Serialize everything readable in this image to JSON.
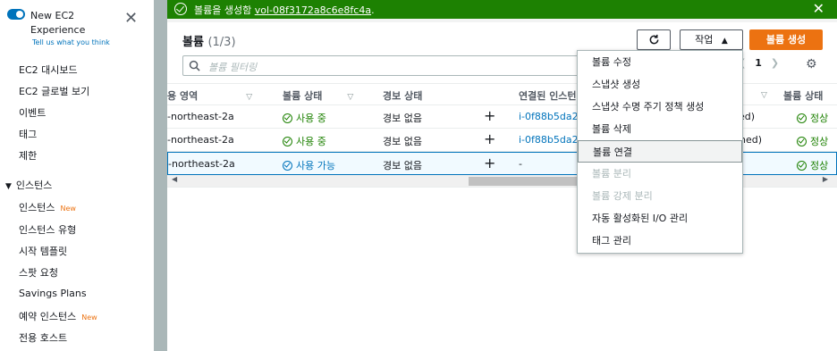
{
  "sidebar": {
    "title": "New EC2 Experience",
    "subtitle": "Tell us what you think",
    "items": [
      {
        "label": "EC2 대시보드"
      },
      {
        "label": "EC2 글로벌 보기"
      },
      {
        "label": "이벤트"
      },
      {
        "label": "태그"
      },
      {
        "label": "제한"
      }
    ],
    "section": "인스턴스",
    "section_items": [
      {
        "label": "인스턴스",
        "badge": "New"
      },
      {
        "label": "인스턴스 유형"
      },
      {
        "label": "시작 템플릿"
      },
      {
        "label": "스팟 요청"
      },
      {
        "label": "Savings Plans"
      },
      {
        "label": "예약 인스턴스",
        "badge": "New"
      },
      {
        "label": "전용 호스트"
      }
    ]
  },
  "flash": {
    "text": "볼륨을 생성함",
    "volume_id": "vol-08f3172a8c6e8fc4a",
    "period": "."
  },
  "panel": {
    "title": "볼륨",
    "count": "(1/3)",
    "action_label": "작업",
    "create_label": "볼륨 생성",
    "search_placeholder": "볼륨 필터링",
    "page": "1"
  },
  "table": {
    "headers": [
      "용 영역",
      "볼륨 상태",
      "경보 상태",
      "연결된 인스턴",
      "볼륨 상태"
    ],
    "rows": [
      {
        "az": "-northeast-2a",
        "state": "사용 중",
        "alarm": "경보 없음",
        "instance": "i-0f88b5da2",
        "attach": "hed)",
        "status": "정상"
      },
      {
        "az": "-northeast-2a",
        "state": "사용 중",
        "alarm": "경보 없음",
        "instance": "i-0f88b5da2",
        "attach": "hed)",
        "status": "정상"
      },
      {
        "az": "-northeast-2a",
        "state": "사용 가능",
        "alarm": "경보 없음",
        "instance": "-",
        "attach": "",
        "status": "정상"
      }
    ]
  },
  "dropdown": {
    "items": [
      {
        "label": "볼륨 수정",
        "disabled": false
      },
      {
        "label": "스냅샷 생성",
        "disabled": false
      },
      {
        "label": "스냅샷 수명 주기 정책 생성",
        "disabled": false
      },
      {
        "label": "볼륨 삭제",
        "disabled": false
      },
      {
        "label": "볼륨 연결",
        "disabled": false
      },
      {
        "label": "볼륨 분리",
        "disabled": true
      },
      {
        "label": "볼륨 강제 분리",
        "disabled": true
      },
      {
        "label": "자동 활성화된 I/O 관리",
        "disabled": false
      },
      {
        "label": "태그 관리",
        "disabled": false
      }
    ]
  },
  "colors": {
    "success": "#1d8102",
    "primary": "#ec7211",
    "link": "#0073bb"
  },
  "icons": [
    "close-icon",
    "check-circle-icon",
    "refresh-icon",
    "caret-up-icon",
    "search-icon",
    "settings-gear-icon",
    "plus-icon",
    "chevron-left-icon",
    "chevron-right-icon"
  ]
}
